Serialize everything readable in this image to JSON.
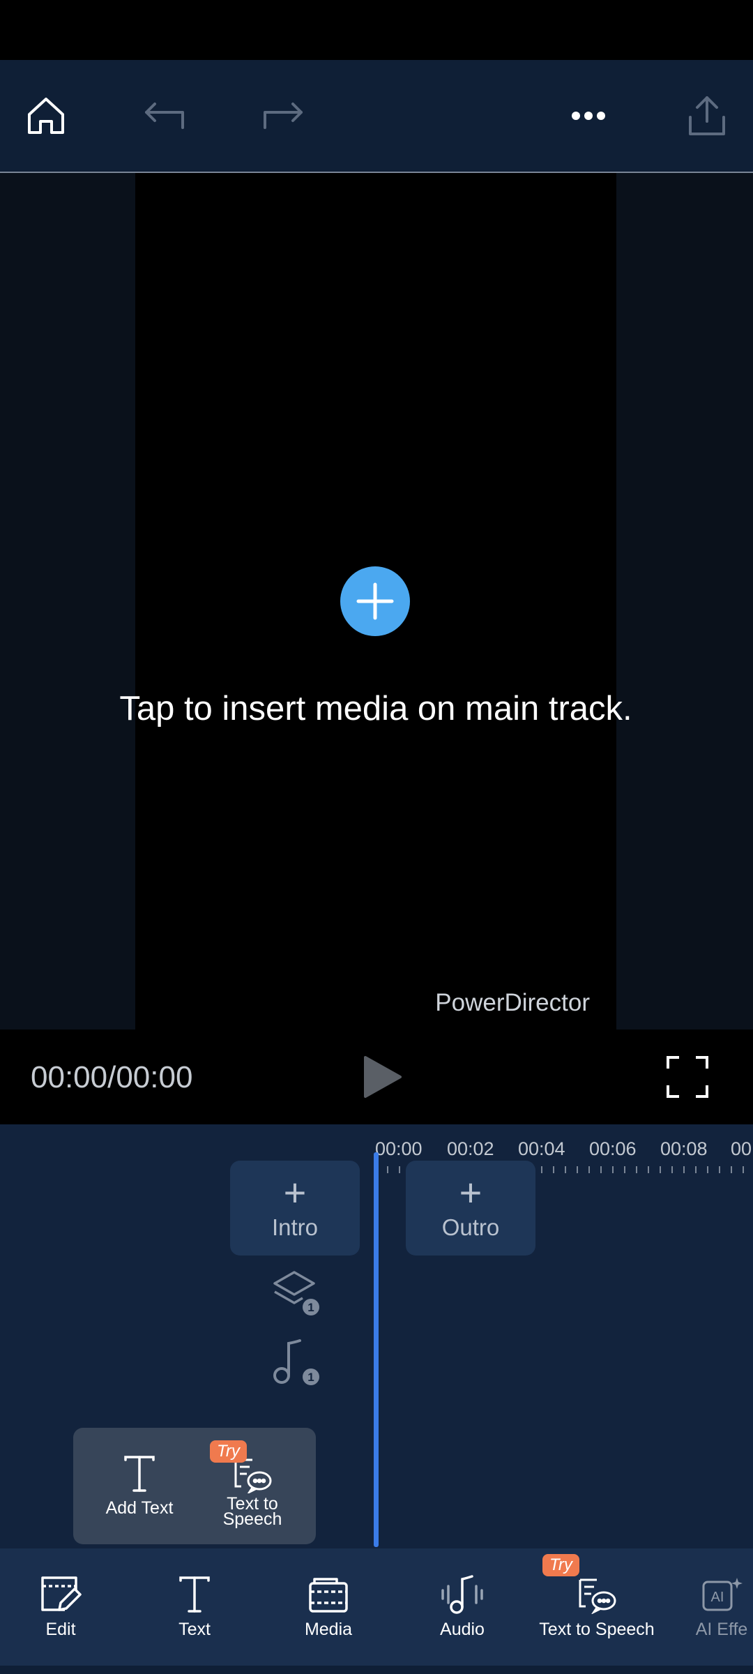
{
  "player": {
    "insert_hint": "Tap to insert media on main track.",
    "watermark": "PowerDirector",
    "timecode": "00:00/00:00"
  },
  "timeline": {
    "ruler_labels": [
      "00:00",
      "00:02",
      "00:04",
      "00:06",
      "00:08",
      "00"
    ],
    "intro_label": "Intro",
    "outro_label": "Outro",
    "overlay_track_count": "1",
    "audio_track_count": "1",
    "playhead_color": "#3b7ce8"
  },
  "text_popup": {
    "add_text_label": "Add Text",
    "tts_label_line1": "Text to",
    "tts_label_line2": "Speech",
    "try_badge": "Try"
  },
  "bottom_nav": {
    "items": [
      {
        "label": "Edit",
        "icon": "edit-icon"
      },
      {
        "label": "Text",
        "icon": "text-icon"
      },
      {
        "label": "Media",
        "icon": "media-icon"
      },
      {
        "label": "Audio",
        "icon": "audio-icon"
      },
      {
        "label": "Text to Speech",
        "icon": "text-to-speech-icon",
        "badge": "Try"
      },
      {
        "label": "AI Effe",
        "icon": "ai-effects-icon"
      }
    ]
  },
  "colors": {
    "accent": "#4ba8f0",
    "try_badge": "#f07a4e",
    "background": "#0f1f36"
  }
}
